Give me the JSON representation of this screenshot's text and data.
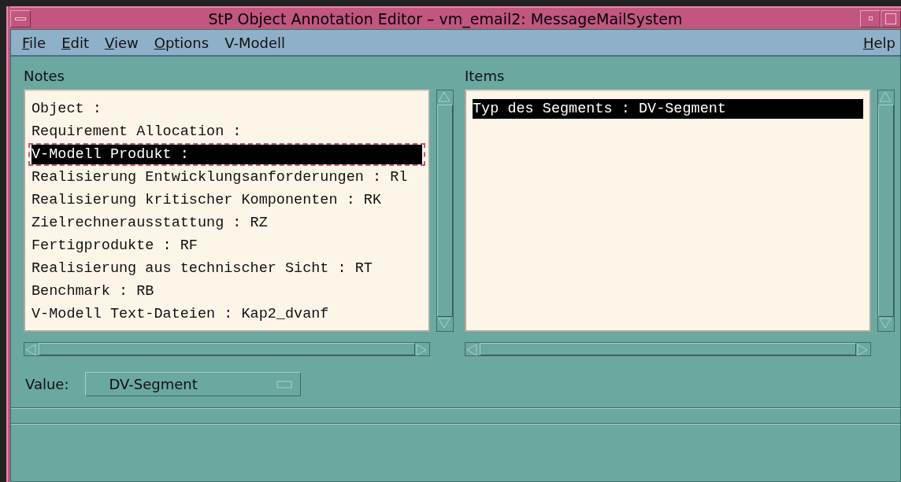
{
  "window": {
    "title": "StP Object Annotation Editor – vm_email2: MessageMailSystem"
  },
  "menu": [
    {
      "label": "File",
      "mnemonic_underlined": true
    },
    {
      "label": "Edit",
      "mnemonic_underlined": true
    },
    {
      "label": "View",
      "mnemonic_underlined": true
    },
    {
      "label": "Options",
      "mnemonic_underlined": true
    },
    {
      "label": "V-Modell",
      "mnemonic_underlined": false
    }
  ],
  "help_menu": {
    "label": "Help",
    "mnemonic_underlined": true
  },
  "notes": {
    "label": "Notes",
    "items": [
      {
        "text": "Object :",
        "selected": false,
        "focused": false
      },
      {
        "text": "Requirement Allocation :",
        "selected": false,
        "focused": false
      },
      {
        "text": "V-Modell Produkt :",
        "selected": true,
        "focused": true
      },
      {
        "text": "Realisierung Entwicklungsanforderungen : Rl",
        "selected": false,
        "focused": false
      },
      {
        "text": "Realisierung kritischer Komponenten : RK",
        "selected": false,
        "focused": false
      },
      {
        "text": "Zielrechnerausstattung : RZ",
        "selected": false,
        "focused": false
      },
      {
        "text": "Fertigprodukte : RF",
        "selected": false,
        "focused": false
      },
      {
        "text": "Realisierung aus technischer Sicht : RT",
        "selected": false,
        "focused": false
      },
      {
        "text": "Benchmark : RB",
        "selected": false,
        "focused": false
      },
      {
        "text": "V-Modell Text-Dateien : Kap2_dvanf",
        "selected": false,
        "focused": false
      }
    ]
  },
  "items": {
    "label": "Items",
    "items": [
      {
        "text": "Typ des Segments : DV-Segment",
        "selected": true,
        "focused": false
      }
    ]
  },
  "value": {
    "label": "Value:",
    "option": "DV-Segment"
  }
}
